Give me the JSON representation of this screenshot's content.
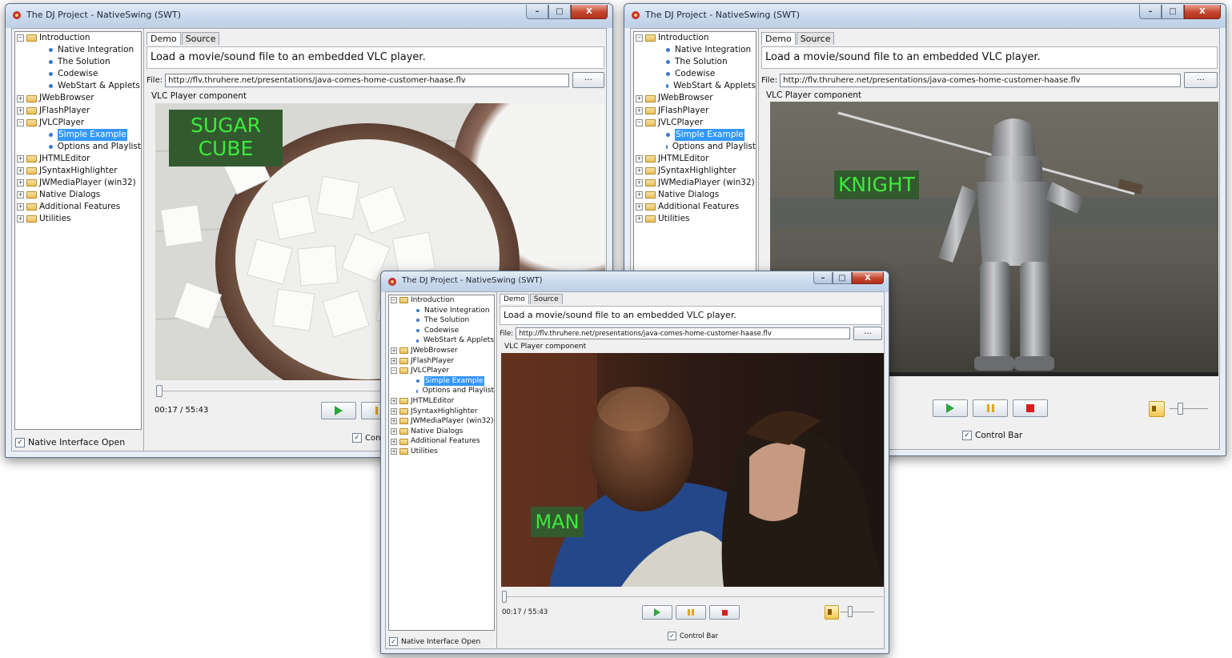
{
  "window": {
    "title": "The DJ Project - NativeSwing (SWT)",
    "buttons": {
      "minimize": "–",
      "maximize": "□",
      "close": "X"
    }
  },
  "tree": {
    "introduction": "Introduction",
    "native_integration": "Native Integration",
    "the_solution": "The Solution",
    "codewise": "Codewise",
    "webstart": "WebStart & Applets",
    "jwebbrowser": "JWebBrowser",
    "jflashplayer": "JFlashPlayer",
    "jvlcplayer": "JVLCPlayer",
    "simple_example": "Simple Example",
    "options_playlist": "Options and Playlist",
    "jhtmleditor": "JHTMLEditor",
    "jsyntaxhighlighter": "JSyntaxHighlighter",
    "jwmediaplayer": "JWMediaPlayer (win32)",
    "native_dialogs": "Native Dialogs",
    "additional_features": "Additional Features",
    "utilities": "Utilities",
    "expand_plus": "+",
    "expand_minus": "−"
  },
  "native_interface_label": "Native Interface Open",
  "tabs": {
    "demo": "Demo",
    "source": "Source"
  },
  "description": "Load a movie/sound file to an embedded VLC player.",
  "file": {
    "label": "File:",
    "value": "http://flv.thruhere.net/presentations/java-comes-home-customer-haase.flv",
    "browse": "..."
  },
  "component_label": "VLC Player component",
  "time": "00:17 / 55:43",
  "control_bar_label": "Control Bar",
  "control_bar_label_cut": "Contr",
  "checkmark": "✓",
  "overlays": {
    "sugar_line1": "SUGAR",
    "sugar_line2": "CUBE",
    "knight": "KNIGHT",
    "man": "MAN"
  }
}
